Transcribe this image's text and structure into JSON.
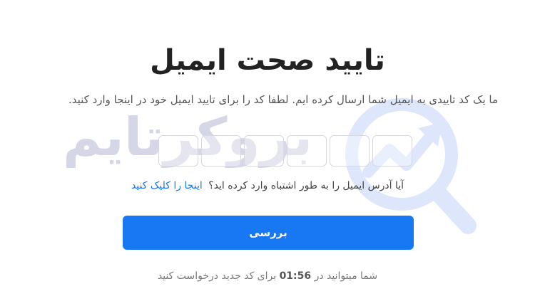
{
  "title": "تایید صحت ایمیل",
  "subtitle": "ما یک کد تاییدی به ایمیل شما ارسال کرده ایم. لطفا کد را برای تایید ایمیل خود در اینجا وارد کنید.",
  "code_inputs": [
    "",
    "",
    "",
    "",
    "",
    ""
  ],
  "wrong_email": {
    "question": "آیا آدرس ایمیل را به طور اشتباه وارد کرده اید؟",
    "link": "اینجا را کلیک کنید"
  },
  "verify_button": "بررسی",
  "resend": {
    "prefix": "شما میتوانید در",
    "timer": "01:56",
    "suffix": "برای کد جدید درخواست کنید"
  },
  "watermark": {
    "text": "بروکرتایم",
    "logo_icon": "magnifier-chart-icon",
    "color": "#d6d7e6",
    "logo_color": "#dde6fb"
  },
  "colors": {
    "accent": "#1877f2",
    "title": "#222222",
    "muted": "#777777"
  }
}
